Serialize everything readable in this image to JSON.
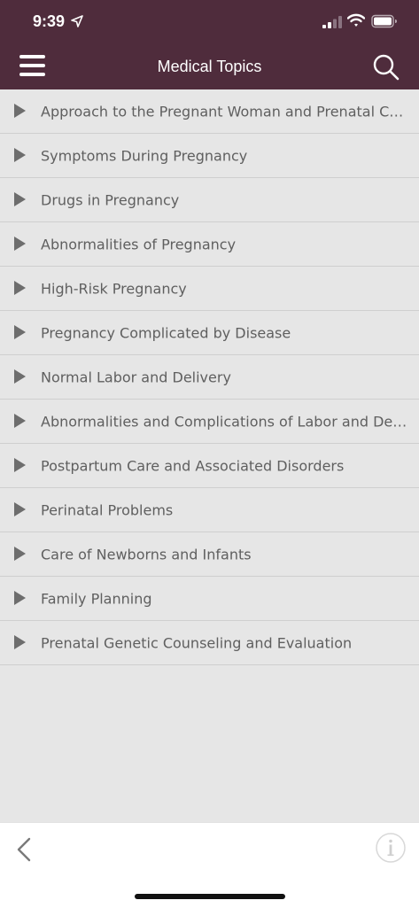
{
  "status_bar": {
    "time": "9:39"
  },
  "nav": {
    "title": "Medical Topics"
  },
  "topics": [
    {
      "label": "Approach to the Pregnant Woman and Prenatal Care"
    },
    {
      "label": "Symptoms During Pregnancy"
    },
    {
      "label": "Drugs in Pregnancy"
    },
    {
      "label": "Abnormalities of Pregnancy"
    },
    {
      "label": "High-Risk Pregnancy"
    },
    {
      "label": "Pregnancy Complicated by Disease"
    },
    {
      "label": "Normal Labor and Delivery"
    },
    {
      "label": "Abnormalities and Complications of Labor and Deliv..."
    },
    {
      "label": "Postpartum Care and Associated Disorders"
    },
    {
      "label": "Perinatal Problems"
    },
    {
      "label": "Care of Newborns and Infants"
    },
    {
      "label": "Family Planning"
    },
    {
      "label": "Prenatal Genetic Counseling and Evaluation"
    }
  ],
  "colors": {
    "header_bg": "#4f2c3c",
    "list_bg": "#e6e6e6",
    "text": "#5f5f5f",
    "arrow": "#6d6d6d"
  },
  "icons": {
    "menu": "hamburger-icon",
    "search": "search-icon",
    "back": "chevron-left-icon",
    "info": "info-icon",
    "row": "triangle-right-icon"
  }
}
